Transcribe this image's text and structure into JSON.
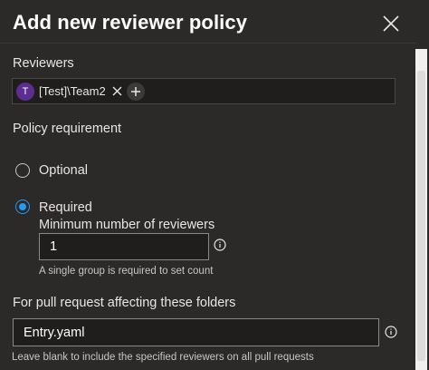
{
  "panel": {
    "title": "Add new reviewer policy"
  },
  "reviewers": {
    "label": "Reviewers",
    "chips": [
      {
        "avatar_initial": "T",
        "name": "[Test]\\Team2"
      }
    ]
  },
  "policy": {
    "label": "Policy requirement",
    "options": [
      {
        "label": "Optional",
        "selected": false
      },
      {
        "label": "Required",
        "selected": true
      }
    ],
    "min_reviewers_label": "Minimum number of reviewers",
    "min_reviewers_value": "1",
    "min_reviewers_helper": "A single group is required to set count"
  },
  "folders": {
    "label": "For pull request affecting these folders",
    "value": "Entry.yaml",
    "helper": "Leave blank to include the specified reviewers on all pull requests"
  },
  "icons": {
    "close": "close-icon",
    "remove": "close-icon",
    "add": "plus-icon",
    "info": "info-icon"
  },
  "colors": {
    "background": "#2b2a29",
    "accent": "#2899f5",
    "avatar": "#5c2e91"
  }
}
